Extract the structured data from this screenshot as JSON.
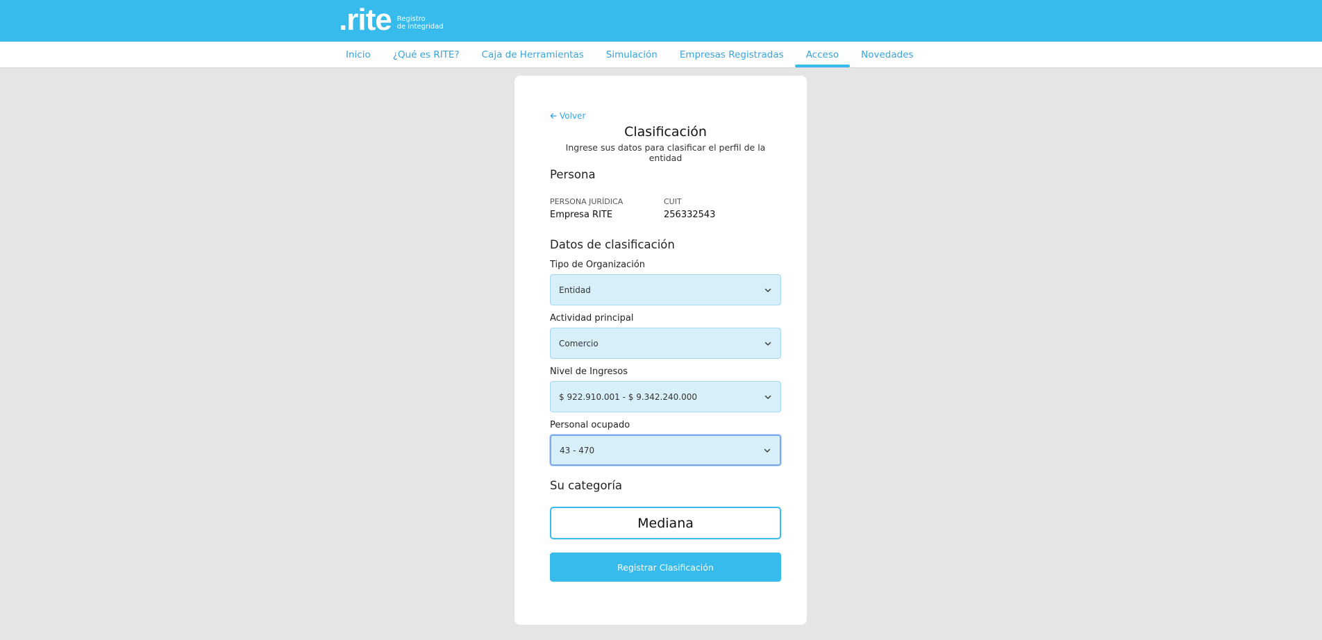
{
  "brand": {
    "logo": ".rite",
    "tagline_line1": "Registro",
    "tagline_line2": "de integridad"
  },
  "nav": {
    "items": [
      {
        "label": "Inicio"
      },
      {
        "label": "¿Qué es RITE?"
      },
      {
        "label": "Caja de Herramientas"
      },
      {
        "label": "Simulación"
      },
      {
        "label": "Empresas Registradas"
      },
      {
        "label": "Acceso"
      },
      {
        "label": "Novedades"
      }
    ],
    "active": "Acceso"
  },
  "page": {
    "back_label": "Volver",
    "title": "Clasificación",
    "subtitle": "Ingrese sus datos para clasificar el perfil de la entidad"
  },
  "persona": {
    "section_title": "Persona",
    "type_label": "PERSONA JURÍDICA",
    "name": "Empresa RITE",
    "cuit_label": "CUIT",
    "cuit": "256332543"
  },
  "clasificacion": {
    "section_title": "Datos de clasificación",
    "fields": [
      {
        "label": "Tipo de Organización",
        "value": "Entidad"
      },
      {
        "label": "Actividad principal",
        "value": "Comercio"
      },
      {
        "label": "Nivel de Ingresos",
        "value": "$ 922.910.001 - $ 9.342.240.000"
      },
      {
        "label": "Personal ocupado",
        "value": "43 - 470"
      }
    ]
  },
  "categoria": {
    "section_title": "Su categoría",
    "value": "Mediana"
  },
  "submit_label": "Registrar Clasificación",
  "colors": {
    "brand": "#37bbed",
    "link": "#37a3e0",
    "field_bg": "#d7eff9",
    "page_bg": "#e5e5e5"
  }
}
